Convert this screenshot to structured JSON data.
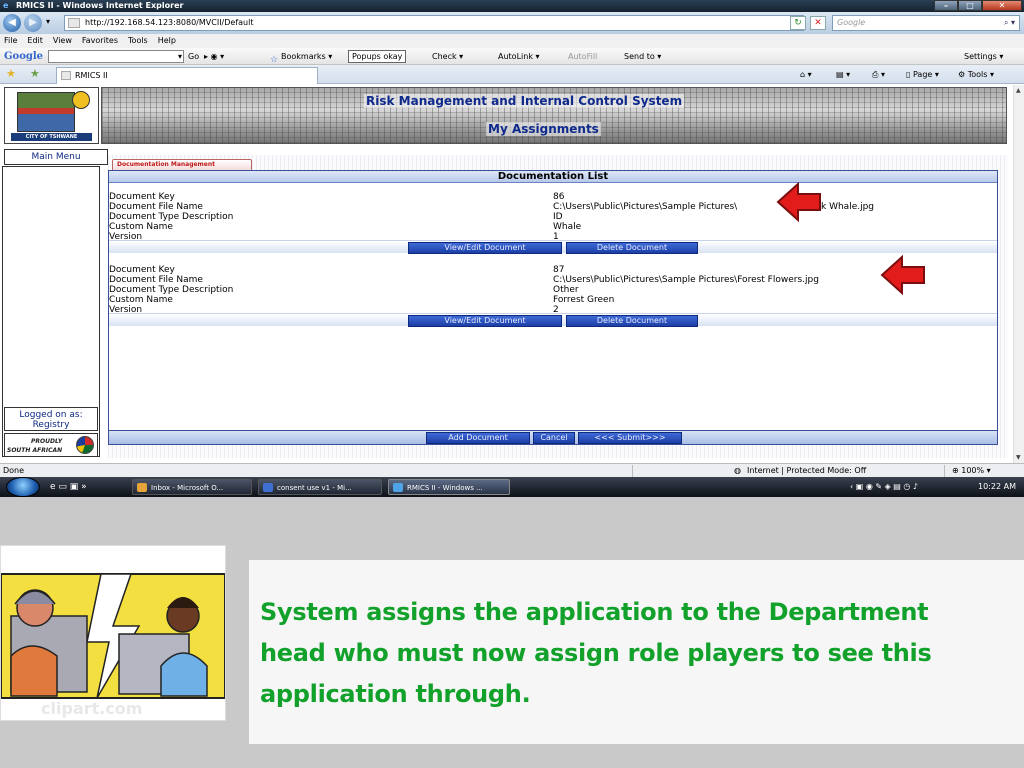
{
  "window": {
    "title": "RMICS II - Windows Internet Explorer",
    "url": "http://192.168.54.123:8080/MVCII/Default",
    "search_placeholder": "Google"
  },
  "menu": [
    "File",
    "Edit",
    "View",
    "Favorites",
    "Tools",
    "Help"
  ],
  "google_toolbar": {
    "logo": "Google",
    "go": "Go",
    "bookmarks": "Bookmarks",
    "popups": "Popups okay",
    "check": "Check",
    "autolink": "AutoLink",
    "autofill": "AutoFill",
    "sendto": "Send to",
    "settings": "Settings"
  },
  "tab": {
    "title": "RMICS II"
  },
  "command_bar": {
    "page": "Page",
    "tools": "Tools"
  },
  "app": {
    "banner_title": "Risk Management and Internal Control System",
    "banner_subtitle": "My Assignments",
    "logo_text": "CITY OF TSHWANE",
    "main_menu": "Main Menu",
    "logged_on_label": "Logged on as:",
    "logged_on_user": "Registry",
    "proudly_1": "PROUDLY",
    "proudly_2": "SOUTH AFRICAN",
    "section_tab": "Documentation Management",
    "list_title": "Documentation List",
    "labels": [
      "Document Key",
      "Document File Name",
      "Document Type Description",
      "Custom Name",
      "Version"
    ],
    "records": [
      {
        "key": "86",
        "file": "C:\\Users\\Public\\Pictures\\Sample Pictures\\",
        "file_tail": "k Whale.jpg",
        "type": "ID",
        "name": "Whale",
        "version": "1"
      },
      {
        "key": "87",
        "file": "C:\\Users\\Public\\Pictures\\Sample Pictures\\Forest Flowers.jpg",
        "file_tail": "",
        "type": "Other",
        "name": "Forrest Green",
        "version": "2"
      }
    ],
    "view_edit": "View/Edit Document",
    "delete": "Delete Document",
    "add_document": "Add Document",
    "cancel": "Cancel",
    "submit": "<<< Submit>>>"
  },
  "status": {
    "text": "Done",
    "zone": "Internet | Protected Mode: Off",
    "zoom": "100%"
  },
  "taskbar": {
    "items": [
      "Inbox - Microsoft O...",
      "consent use v1 - Mi...",
      "RMICS II - Windows ..."
    ],
    "time": "10:22 AM"
  },
  "caption": "System assigns the application to the Department head who must now assign role players to see this application through.",
  "colors": {
    "caption": "#12a12a",
    "banner_text": "#0f2a8c",
    "button": "#1c3ea6",
    "arrow": "#e21b1b"
  }
}
